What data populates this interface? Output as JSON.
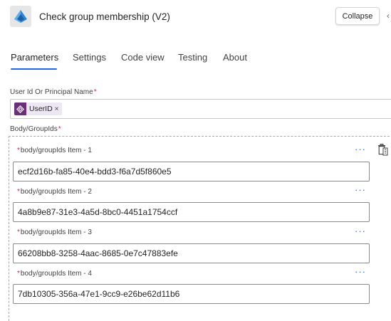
{
  "header": {
    "title": "Check group membership (V2)",
    "collapse_label": "Collapse",
    "icon": "azure-ad-icon"
  },
  "tabs": [
    {
      "label": "Parameters",
      "active": true
    },
    {
      "label": "Settings",
      "active": false
    },
    {
      "label": "Code view",
      "active": false
    },
    {
      "label": "Testing",
      "active": false
    },
    {
      "label": "About",
      "active": false
    }
  ],
  "fields": {
    "user_id": {
      "label": "User Id Or Principal Name",
      "required": "*",
      "token": {
        "label": "UserID",
        "remove": "×",
        "icon": "dynamic-content-icon"
      }
    },
    "group_ids": {
      "label": "Body/GroupIds",
      "required": "*",
      "items": [
        {
          "label": "body/groupIds Item - 1",
          "value": "ecf2d16b-fa85-40e4-bdd3-f6a7d5f860e5"
        },
        {
          "label": "body/groupIds Item - 2",
          "value": "4a8b9e87-31e3-4a5d-8bc0-4451a1754ccf"
        },
        {
          "label": "body/groupIds Item - 3",
          "value": "66208bb8-3258-4aac-8685-0e7c47883efe"
        },
        {
          "label": "body/groupIds Item - 4",
          "value": "7db10305-356a-47e1-9cc9-e26be62d11b6"
        }
      ]
    }
  },
  "menu_glyph": "···",
  "colors": {
    "accent": "#2266e3",
    "required": "#c4314b",
    "token_icon_bg": "#6b2f7a",
    "token_bg": "#ece7f3"
  }
}
